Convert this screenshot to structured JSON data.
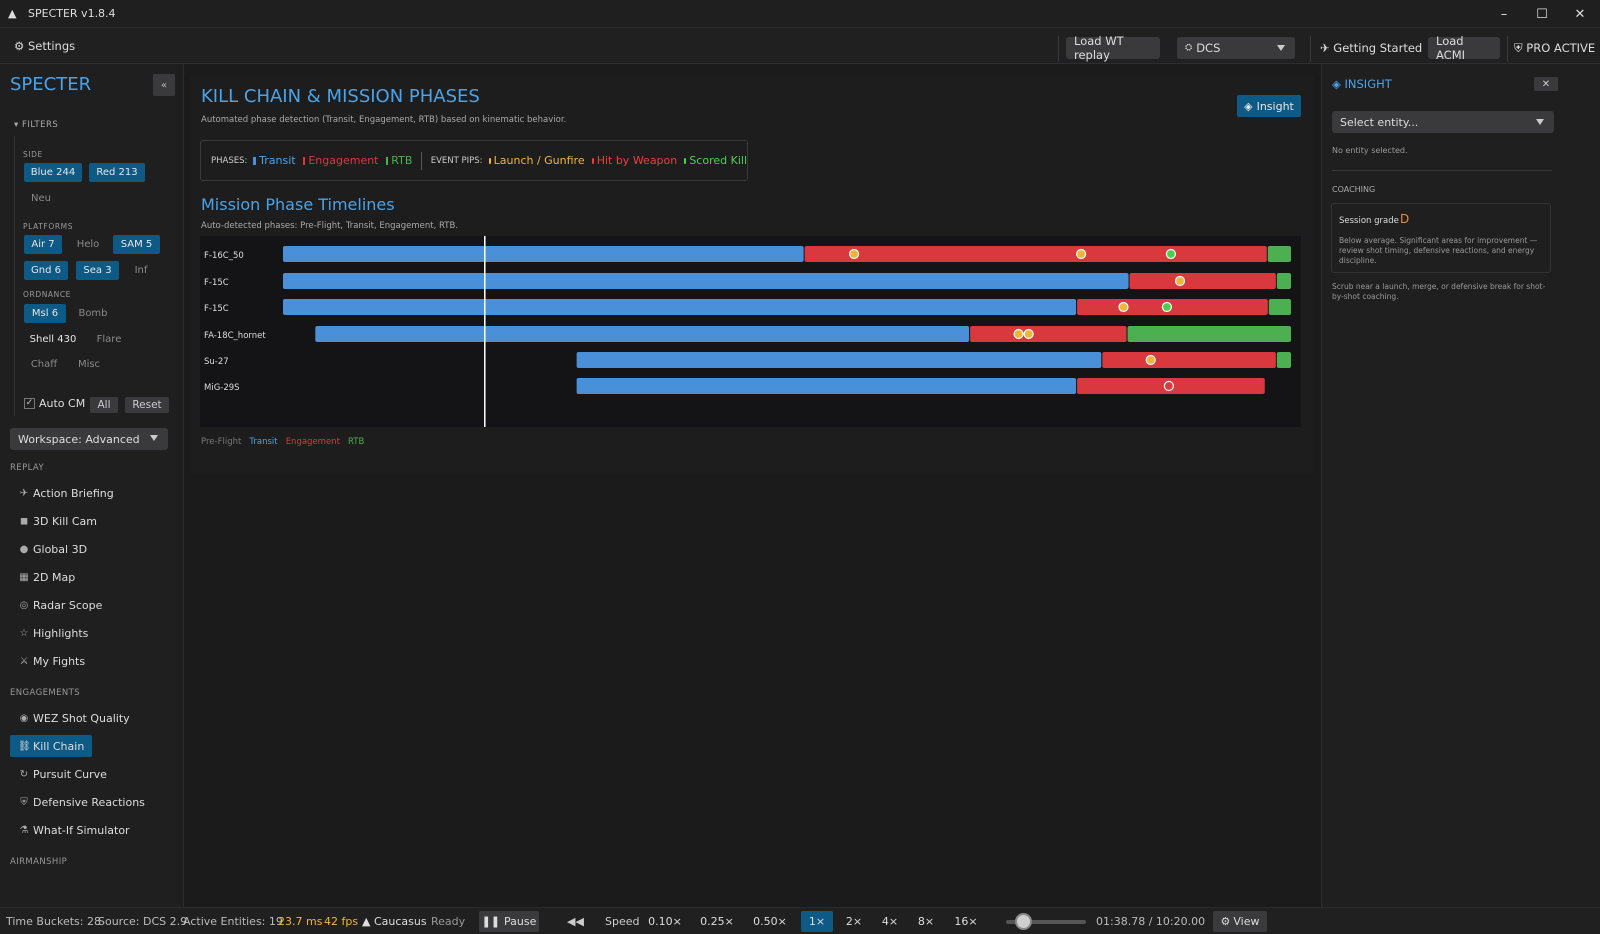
{
  "window": {
    "title": "SPECTER v1.8.4"
  },
  "menubar": {
    "settings": "Settings",
    "load_wt": "Load WT replay",
    "sim_select": "DCS",
    "getting_started": "Getting Started",
    "load_acmi": "Load ACMI",
    "pro": "PRO ACTIVE"
  },
  "sidebar": {
    "brand": "SPECTER",
    "collapse": "«",
    "filters_heading": "FILTERS",
    "side_label": "SIDE",
    "side_chips": [
      "Blue 244",
      "Red 213",
      "Neu"
    ],
    "platforms_label": "PLATFORMS",
    "platform_chips": [
      "Air 7",
      "Helo",
      "SAM 5",
      "Gnd 6",
      "Sea 3",
      "Inf"
    ],
    "ordnance_label": "ORDNANCE",
    "ordnance_chips": [
      "Msl 6",
      "Bomb",
      "Shell 430",
      "Flare",
      "Chaff",
      "Misc"
    ],
    "auto_cm": "Auto CM",
    "all": "All",
    "reset": "Reset",
    "workspace": "Workspace: Advanced",
    "replay_label": "REPLAY",
    "replay_items": [
      "Action Briefing",
      "3D Kill Cam",
      "Global 3D",
      "2D Map",
      "Radar Scope",
      "Highlights",
      "My Fights"
    ],
    "engagements_label": "ENGAGEMENTS",
    "engagement_items": [
      "WEZ Shot Quality",
      "Kill Chain",
      "Pursuit Curve",
      "Defensive Reactions",
      "What-If Simulator"
    ],
    "airmanship_label": "AIRMANSHIP"
  },
  "main": {
    "title": "KILL CHAIN & MISSION PHASES",
    "subtitle": "Automated phase detection (Transit, Engagement, RTB) based on kinematic behavior.",
    "insight_button": "Insight",
    "legend": {
      "phases_label": "PHASES:",
      "transit": "Transit",
      "engagement": "Engagement",
      "rtb": "RTB",
      "pips_label": "EVENT PIPS:",
      "launch": "Launch / Gunfire",
      "hit": "Hit by Weapon",
      "kill": "Scored Kill"
    },
    "timeline_title": "Mission Phase Timelines",
    "timeline_subtitle": "Auto-detected phases: Pre-Flight, Transit, Engagement, RTB.",
    "phase_legend": {
      "preflight": "Pre-Flight",
      "transit": "Transit",
      "engagement": "Engagement",
      "rtb": "RTB"
    }
  },
  "colors": {
    "transit": "#4a90d9",
    "engagement": "#d9393e",
    "rtb": "#4caf50",
    "launch": "#f0b43c",
    "hit": "#e8403c",
    "kill": "#4cd04c",
    "accent": "#4aa3e8"
  },
  "chart_data": {
    "type": "timeline",
    "cursor_fraction": 0.2
  },
  "insight": {
    "title": "INSIGHT",
    "select_placeholder": "Select entity...",
    "no_entity": "No entity selected.",
    "coaching_label": "COACHING",
    "grade_label": "Session grade",
    "grade": "D",
    "grade_text": "Below average. Significant areas for improvement — review shot timing, defensive reactions, and energy discipline.",
    "hint": "Scrub near a launch, merge, or defensive break for shot-by-shot coaching."
  },
  "status": {
    "time_buckets": "Time Buckets: 28",
    "source": "Source: DCS 2.9",
    "entities": "Active Entities: 19",
    "ms": "23.7 ms",
    "fps": "42 fps",
    "map": "Caucasus",
    "ready": "Ready",
    "pause": "Pause",
    "speed_label": "Speed",
    "speeds": [
      "0.10×",
      "0.25×",
      "0.50×",
      "1×",
      "2×",
      "4×",
      "8×",
      "16×"
    ],
    "time": "01:38.78 / 10:20.00",
    "view": "View"
  }
}
